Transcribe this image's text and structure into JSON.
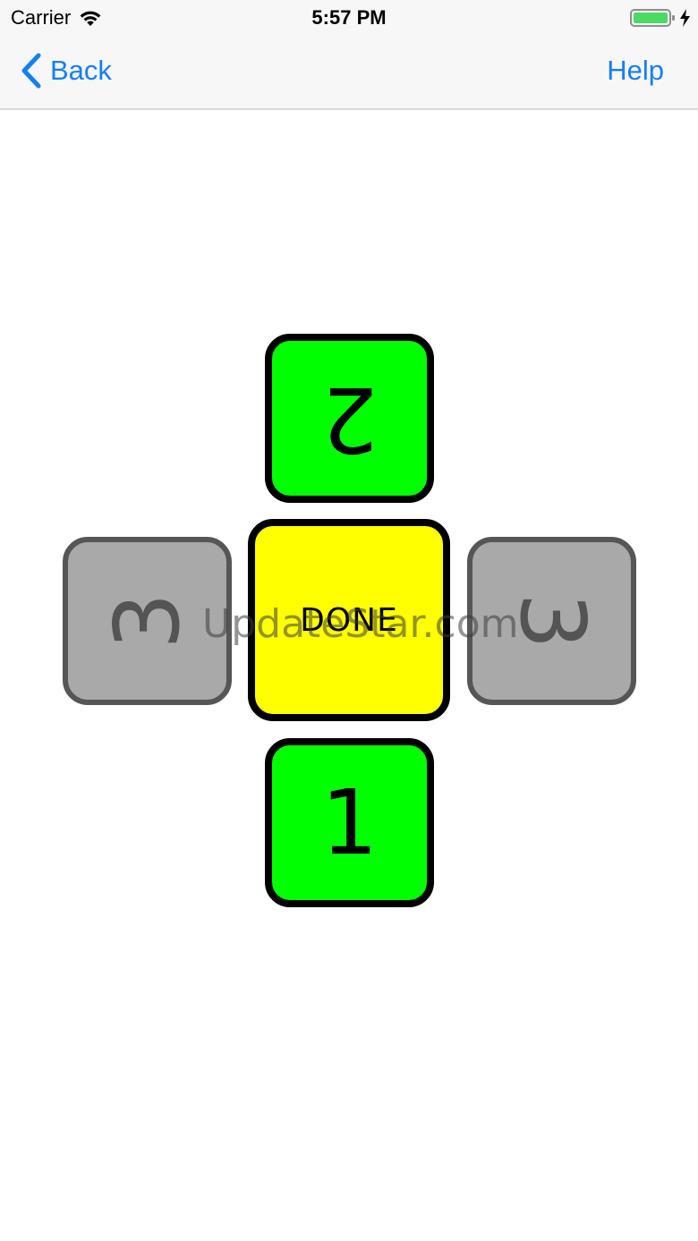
{
  "status_bar": {
    "carrier": "Carrier",
    "time": "5:57 PM",
    "wifi_icon": "wifi-icon",
    "battery_icon": "battery-charging-icon",
    "battery_level": 1.0,
    "battery_color": "#4cd964"
  },
  "nav_bar": {
    "back_label": "Back",
    "back_icon": "chevron-left-icon",
    "help_label": "Help",
    "tint_color": "#147efb"
  },
  "board": {
    "top_tile": {
      "label": "2",
      "color": "#00ff00",
      "orientation": "upside-down"
    },
    "left_tile": {
      "label": "3",
      "color": "#a9a9a9",
      "orientation": "rotated-left",
      "state": "disabled"
    },
    "center_tile": {
      "label": "DONE",
      "color": "#ffff00"
    },
    "right_tile": {
      "label": "3",
      "color": "#a9a9a9",
      "orientation": "rotated-right",
      "state": "disabled"
    },
    "bottom_tile": {
      "label": "1",
      "color": "#00ff00",
      "orientation": "upright"
    }
  },
  "watermark": "UpdateStar.com"
}
